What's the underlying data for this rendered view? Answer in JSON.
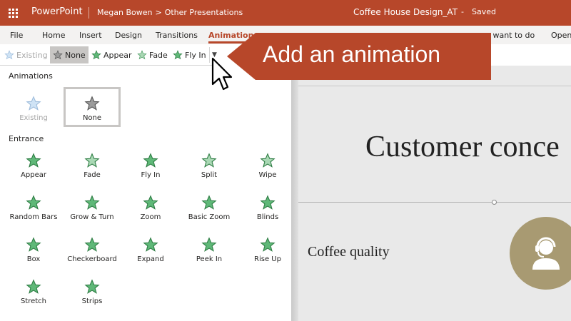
{
  "titlebar": {
    "app_name": "PowerPoint",
    "user": "Megan Bowen",
    "breadcrumb_sep": ">",
    "folder": "Other Presentations",
    "doc_title": "Coffee House Design_AT",
    "dash": "-",
    "status": "Saved"
  },
  "ribbon": {
    "tabs": [
      "File",
      "Home",
      "Insert",
      "Design",
      "Transitions",
      "Animations"
    ],
    "tell_me": "u want to do",
    "open": "Open"
  },
  "gallery": {
    "items": [
      "Existing",
      "None",
      "Appear",
      "Fade",
      "Fly In"
    ]
  },
  "callout": {
    "text": "Add an animation"
  },
  "panel": {
    "animations_title": "Animations",
    "animations": [
      "Existing",
      "None"
    ],
    "entrance_title": "Entrance",
    "entrance": [
      "Appear",
      "Fade",
      "Fly In",
      "Split",
      "Wipe",
      "Random Bars",
      "Grow & Turn",
      "Zoom",
      "Basic Zoom",
      "Blinds",
      "Box",
      "Checkerboard",
      "Expand",
      "Peek In",
      "Rise Up",
      "Stretch",
      "Strips"
    ]
  },
  "slide": {
    "title": "Customer conce",
    "bullet": "Coffee quality"
  },
  "colors": {
    "brand": "#b7472a",
    "star_green": "#5fb878",
    "star_light": "#a9d8b4",
    "slide_accent": "#a89a72"
  }
}
